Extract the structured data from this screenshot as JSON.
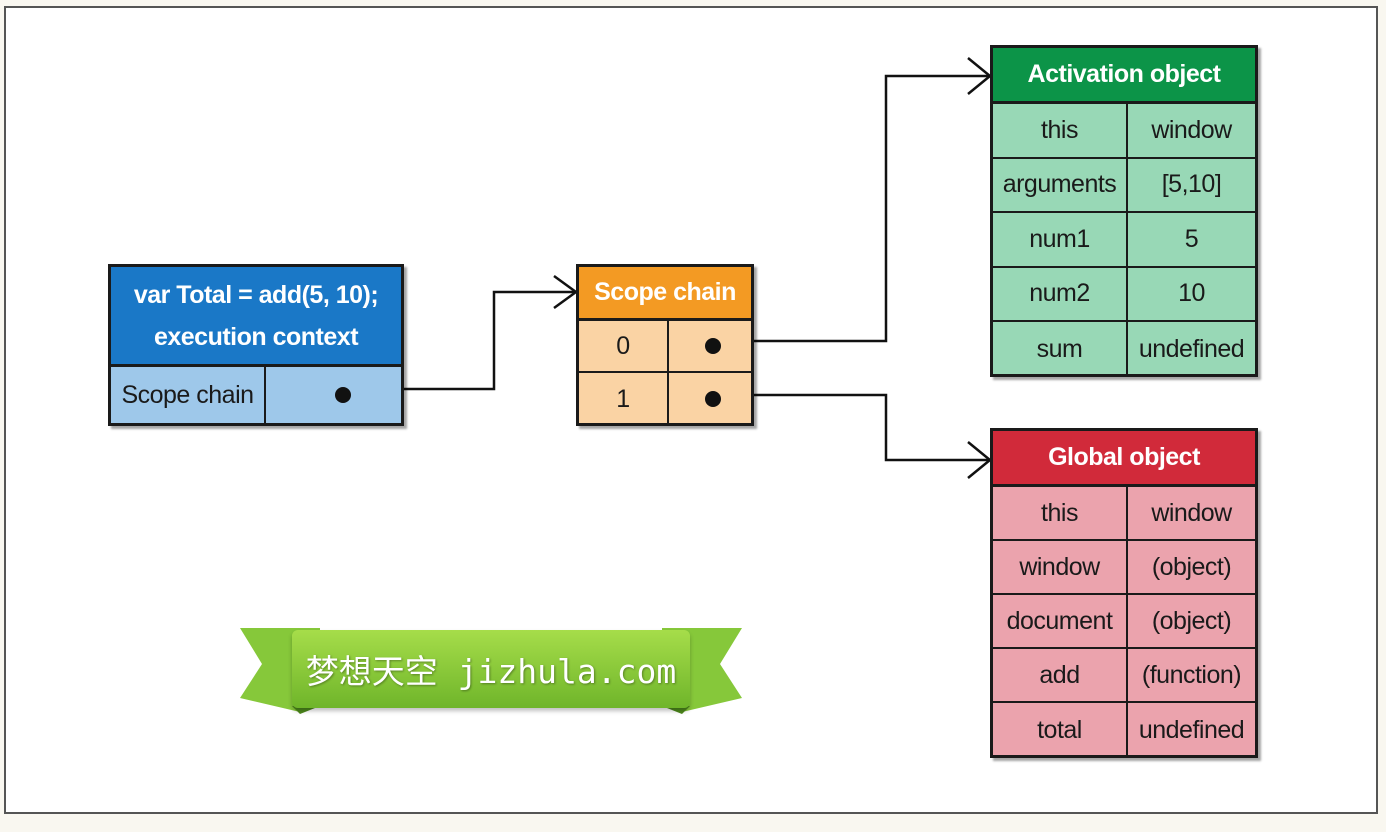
{
  "execution_context": {
    "title_line1": "var Total = add(5, 10);",
    "title_line2": "execution context",
    "row_label": "Scope chain",
    "color": "#1a78c7"
  },
  "scope_chain": {
    "title": "Scope chain",
    "rows": [
      "0",
      "1"
    ],
    "color": "#f39a23"
  },
  "activation_object": {
    "title": "Activation object",
    "color": "#0c9448",
    "rows": [
      {
        "key": "this",
        "value": "window"
      },
      {
        "key": "arguments",
        "value": "[5,10]"
      },
      {
        "key": "num1",
        "value": "5"
      },
      {
        "key": "num2",
        "value": "10"
      },
      {
        "key": "sum",
        "value": "undefined"
      }
    ]
  },
  "global_object": {
    "title": "Global object",
    "color": "#d12a3a",
    "rows": [
      {
        "key": "this",
        "value": "window"
      },
      {
        "key": "window",
        "value": "(object)"
      },
      {
        "key": "document",
        "value": "(object)"
      },
      {
        "key": "add",
        "value": "(function)"
      },
      {
        "key": "total",
        "value": "undefined"
      }
    ]
  },
  "watermark": {
    "text": "梦想天空 jizhula.com"
  }
}
